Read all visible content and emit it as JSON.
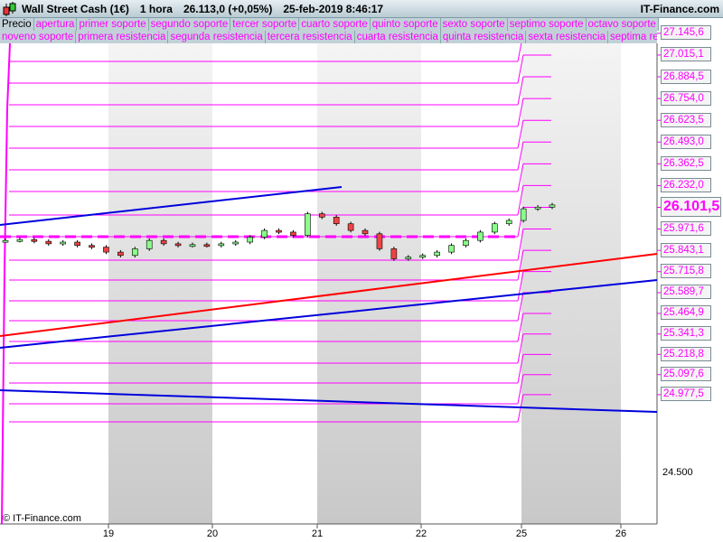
{
  "header": {
    "title": "Wall Street Cash (1€)",
    "timeframe": "1 hora",
    "price": "26.113,0 (+0,05%)",
    "datetime": "25-feb-2019 8:46:17",
    "site": "IT-Finance.com"
  },
  "legend_row1": [
    "Precio",
    "apertura",
    "primer soporte",
    "segundo soporte",
    "tercer soporte",
    "cuarto soporte",
    "quinto soporte",
    "sexto soporte",
    "septimo soporte",
    "octavo soporte"
  ],
  "legend_row2": [
    "noveno soporte",
    "primera resistencia",
    "segunda resistencia",
    "tercera resistencia",
    "cuarta resistencia",
    "quinta resistencia",
    "sexta resistencia",
    "septima resister"
  ],
  "copyright": "© IT-Finance.com",
  "colors": {
    "levels": "#ff00ff",
    "trend_blue": "#0000dd",
    "trend_red": "#ff0000"
  },
  "chart_data": {
    "type": "candlestick",
    "title": "Wall Street Cash (1€) 1 hora",
    "x_ticks": [
      "19",
      "20",
      "21",
      "22",
      "25",
      "26"
    ],
    "level_labels": [
      "27.145,6",
      "27.015,1",
      "26.884,5",
      "26.754,0",
      "26.623,5",
      "26.493,0",
      "26.362,5",
      "26.232,0",
      "26.101,5",
      "25.971,6",
      "25.843,1",
      "25.715,8",
      "25.589,7",
      "25.464,9",
      "25.341,3",
      "25.218,8",
      "25.097,6",
      "24.977,5"
    ],
    "levels": [
      27145.6,
      27015.1,
      26884.5,
      26754.0,
      26623.5,
      26493.0,
      26362.5,
      26232.0,
      26101.5,
      25971.6,
      25843.1,
      25715.8,
      25589.7,
      25464.9,
      25341.3,
      25218.8,
      25097.6,
      24977.5
    ],
    "current_index": 8,
    "y_tick": "24.500",
    "opening_level": 25917,
    "approx_closes": [
      25900,
      25905,
      25895,
      25880,
      25890,
      25870,
      25860,
      25830,
      25810,
      25850,
      25900,
      25880,
      25870,
      25875,
      25870,
      25880,
      25890,
      25920,
      25960,
      25950,
      25930,
      26060,
      26040,
      26000,
      25960,
      25940,
      25850,
      25790,
      25800,
      25810,
      25830,
      25870,
      25900,
      25950,
      26000,
      26020,
      26090,
      26100,
      26113
    ]
  }
}
